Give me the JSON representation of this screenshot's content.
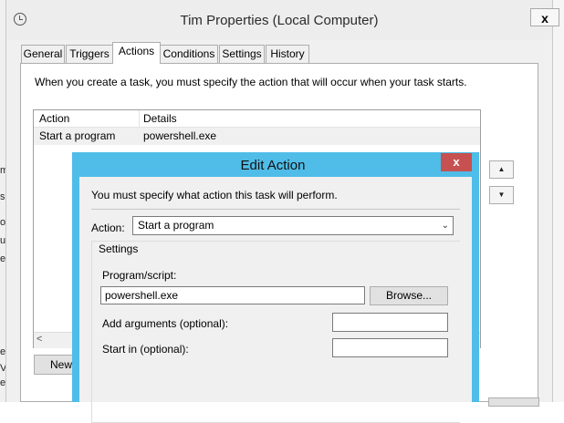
{
  "properties_window": {
    "title": "Tim Properties (Local Computer)",
    "close": "x",
    "tabs": [
      "General",
      "Triggers",
      "Actions",
      "Conditions",
      "Settings",
      "History"
    ],
    "active_tab": "Actions",
    "instruction": "When you create a task, you must specify the action that will occur when your task starts.",
    "list": {
      "columns": [
        "Action",
        "Details"
      ],
      "rows": [
        {
          "action": "Start a program",
          "details": "powershell.exe"
        }
      ]
    },
    "new_button": "New"
  },
  "edit_action": {
    "title": "Edit Action",
    "close": "x",
    "instruction": "You must specify what action this task will perform.",
    "action_label": "Action:",
    "action_value": "Start a program",
    "settings_label": "Settings",
    "program_label": "Program/script:",
    "program_value": "powershell.exe",
    "browse_button": "Browse...",
    "args_label": "Add arguments (optional):",
    "args_value": "",
    "start_in_label": "Start in (optional):",
    "start_in_value": ""
  }
}
